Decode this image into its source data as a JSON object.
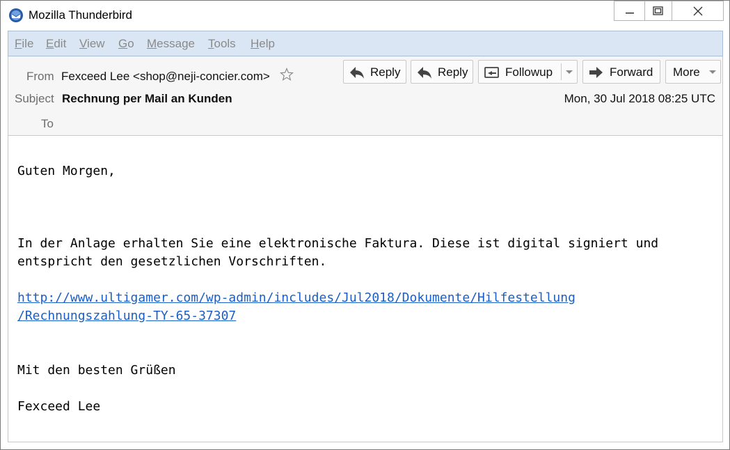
{
  "window": {
    "title": "Mozilla Thunderbird"
  },
  "menu": [
    {
      "accel": "F",
      "rest": "ile"
    },
    {
      "accel": "E",
      "rest": "dit"
    },
    {
      "accel": "V",
      "rest": "iew"
    },
    {
      "accel": "G",
      "rest": "o"
    },
    {
      "accel": "M",
      "rest": "essage"
    },
    {
      "accel": "T",
      "rest": "ools"
    },
    {
      "accel": "H",
      "rest": "elp"
    }
  ],
  "header": {
    "from_label": "From",
    "from_value": "Fexceed Lee <shop@neji-concier.com>",
    "subject_label": "Subject",
    "subject_value": "Rechnung per Mail an Kunden",
    "to_label": "To",
    "date": "Mon, 30 Jul 2018 08:25 UTC"
  },
  "toolbar": {
    "reply_label": "Reply",
    "reply_all_label": "Reply",
    "followup_label": "Followup",
    "forward_label": "Forward",
    "more_label": "More"
  },
  "body": {
    "greeting": "Guten Morgen,",
    "line1": "In der Anlage erhalten Sie eine elektronische Faktura. Diese ist digital signiert und",
    "line2": "entspricht den gesetzlichen Vorschriften.",
    "link_line1": "http://www.ultigamer.com/wp-admin/includes/Jul2018/Dokumente/Hilfestellung",
    "link_line2": "/Rechnungszahlung-TY-65-37307",
    "closing": "Mit den besten Grüßen",
    "signature": "Fexceed Lee"
  },
  "colors": {
    "menubar_bg": "#dbe6f4",
    "link": "#1a5fc9",
    "header_bg": "#f6f6f6"
  }
}
